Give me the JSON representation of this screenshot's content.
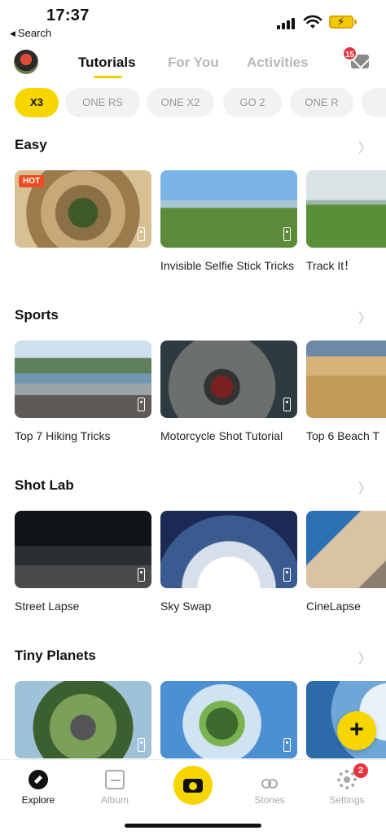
{
  "status_bar": {
    "time": "17:37",
    "back_label": "Search",
    "battery_color": "#f5c800"
  },
  "header": {
    "tabs": [
      {
        "label": "Tutorials",
        "active": true
      },
      {
        "label": "For You",
        "active": false
      },
      {
        "label": "Activities",
        "active": false
      }
    ],
    "mail_badge": "15",
    "accent_color": "#f7d600"
  },
  "chips": [
    {
      "label": "X3",
      "active": true
    },
    {
      "label": "ONE RS",
      "active": false
    },
    {
      "label": "ONE X2",
      "active": false
    },
    {
      "label": "GO 2",
      "active": false
    },
    {
      "label": "ONE R",
      "active": false
    }
  ],
  "sections": [
    {
      "title": "Easy",
      "cards": [
        {
          "title": "",
          "badge": "HOT",
          "thumb": "basket"
        },
        {
          "title": "Invisible Selfie Stick Tricks",
          "thumb": "selfie"
        },
        {
          "title": "Track It！",
          "thumb": "track"
        }
      ]
    },
    {
      "title": "Sports",
      "cards": [
        {
          "title": "Top 7 Hiking Tricks",
          "thumb": "hike"
        },
        {
          "title": "Motorcycle Shot Tutorial",
          "thumb": "moto"
        },
        {
          "title": "Top 6 Beach T",
          "thumb": "beach"
        }
      ]
    },
    {
      "title": "Shot Lab",
      "cards": [
        {
          "title": "Street Lapse",
          "thumb": "street"
        },
        {
          "title": "Sky Swap",
          "thumb": "sky"
        },
        {
          "title": "CineLapse",
          "thumb": "cine"
        }
      ]
    },
    {
      "title": "Tiny Planets",
      "cards": [
        {
          "title": "",
          "thumb": "planet1"
        },
        {
          "title": "",
          "thumb": "planet2"
        },
        {
          "title": "",
          "thumb": "planet3"
        }
      ]
    }
  ],
  "fab": {
    "symbol": "+"
  },
  "bottom_nav": {
    "items": [
      {
        "label": "Explore",
        "icon": "compass-icon",
        "active": true
      },
      {
        "label": "Album",
        "icon": "album-icon",
        "active": false
      },
      {
        "label": "",
        "icon": "camera-icon",
        "active": false
      },
      {
        "label": "Stories",
        "icon": "stories-icon",
        "active": false
      },
      {
        "label": "Settings",
        "icon": "gear-icon",
        "active": false
      }
    ],
    "settings_badge": "2"
  }
}
